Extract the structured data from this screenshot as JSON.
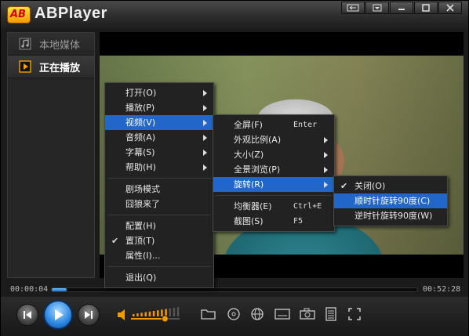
{
  "app": {
    "title": "ABPlayer",
    "logo_text": "AB"
  },
  "sidebar": {
    "items": [
      {
        "label": "本地媒体",
        "active": false
      },
      {
        "label": "正在播放",
        "active": true
      }
    ]
  },
  "playback": {
    "current_time": "00:00:04",
    "total_time": "00:52:28",
    "progress": 0.04,
    "volume": 0.7
  },
  "main_menu": [
    {
      "label": "打开(O)",
      "submenu": true
    },
    {
      "label": "播放(P)",
      "submenu": true
    },
    {
      "label": "视频(V)",
      "submenu": true,
      "highlighted": true
    },
    {
      "label": "音频(A)",
      "submenu": true
    },
    {
      "label": "字幕(S)",
      "submenu": true
    },
    {
      "label": "帮助(H)",
      "submenu": true
    },
    {
      "label": "剧场模式"
    },
    {
      "label": "囧狼来了"
    },
    {
      "label": "配置(H)"
    },
    {
      "label": "置顶(T)",
      "checked": true
    },
    {
      "label": "属性(I)..."
    },
    {
      "label": "退出(Q)"
    }
  ],
  "video_menu": [
    {
      "label": "全屏(F)",
      "shortcut": "Enter"
    },
    {
      "label": "外观比例(A)",
      "submenu": true
    },
    {
      "label": "大小(Z)",
      "submenu": true
    },
    {
      "label": "全景浏览(P)",
      "submenu": true
    },
    {
      "label": "旋转(R)",
      "submenu": true,
      "highlighted": true
    },
    {
      "label": "均衡器(E)",
      "shortcut": "Ctrl+E"
    },
    {
      "label": "截图(S)",
      "shortcut": "F5"
    }
  ],
  "rotate_menu": [
    {
      "label": "关闭(O)",
      "checked": true
    },
    {
      "label": "顺时针旋转90度(C)",
      "highlighted": true
    },
    {
      "label": "逆时针旋转90度(W)"
    }
  ],
  "colors": {
    "accent": "#2166c8",
    "play_button": "#2b86e0",
    "volume": "#f29a00"
  },
  "icons": {
    "prev": "previous-icon",
    "play": "play-icon",
    "next": "next-icon",
    "volume": "volume-icon",
    "open": "folder-icon",
    "disc": "disc-icon",
    "web": "globe-icon",
    "subtitle": "subtitle-icon",
    "snapshot": "camera-icon",
    "playlist": "playlist-icon",
    "fullscreen": "fullscreen-icon"
  }
}
